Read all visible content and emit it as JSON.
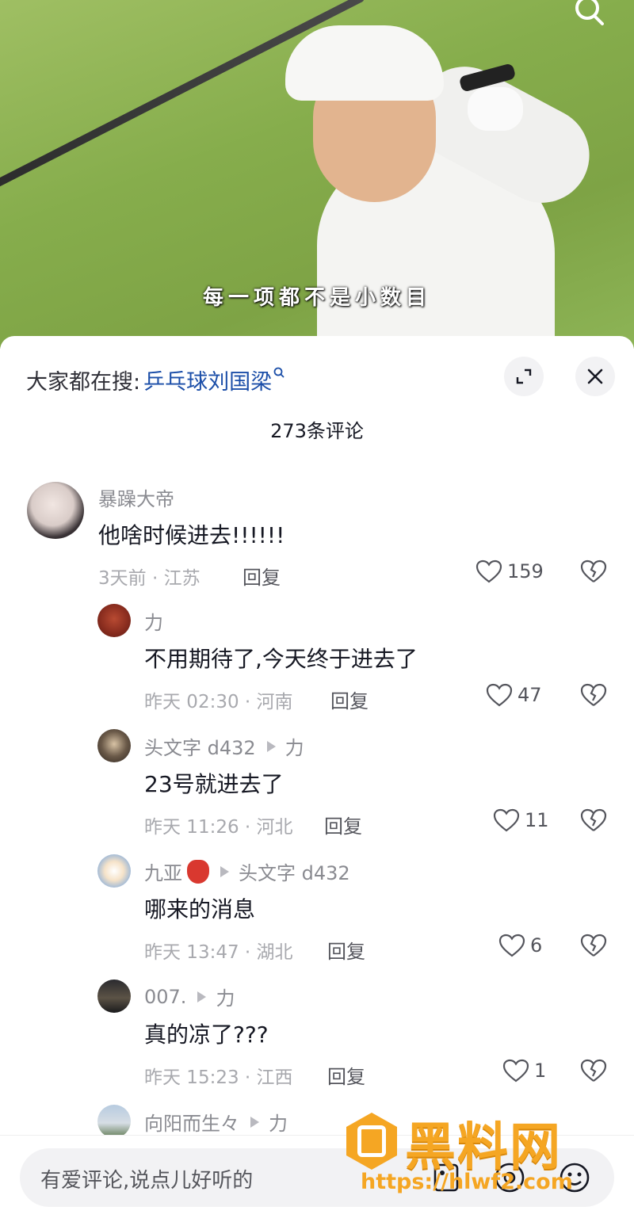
{
  "video": {
    "caption": "每一项都不是小数目"
  },
  "sheet": {
    "hot_search_label": "大家都在搜:",
    "hot_search_term": "乒乓球刘国梁",
    "comment_count": "273条评论"
  },
  "comments": [
    {
      "name": "暴躁大帝",
      "text": "他啥时候进去!!!!!!",
      "meta": "3天前 · 江苏",
      "reply": "回复",
      "likes": "159"
    },
    {
      "name": "力",
      "text": "不用期待了,今天终于进去了",
      "meta": "昨天 02:30 · 河南",
      "reply": "回复",
      "likes": "47"
    },
    {
      "name": "头文字 d432",
      "reply_to": "力",
      "text": "23号就进去了",
      "meta": "昨天 11:26 · 河北",
      "reply": "回复",
      "likes": "11"
    },
    {
      "name": "九亚",
      "reply_to": "头文字 d432",
      "text": "哪来的消息",
      "meta": "昨天 13:47 · 湖北",
      "reply": "回复",
      "likes": "6"
    },
    {
      "name": "007.",
      "reply_to": "力",
      "text": "真的凉了???",
      "meta": "昨天 15:23 · 江西",
      "reply": "回复",
      "likes": "1"
    },
    {
      "name": "向阳而生々",
      "reply_to": "力"
    }
  ],
  "input": {
    "placeholder": "有爱评论,说点儿好听的"
  },
  "watermark": {
    "brand": "黑料网",
    "url": "https://hlwf2.com"
  },
  "colors": {
    "link": "#1b4ea8",
    "watermark": "#f5a623"
  }
}
